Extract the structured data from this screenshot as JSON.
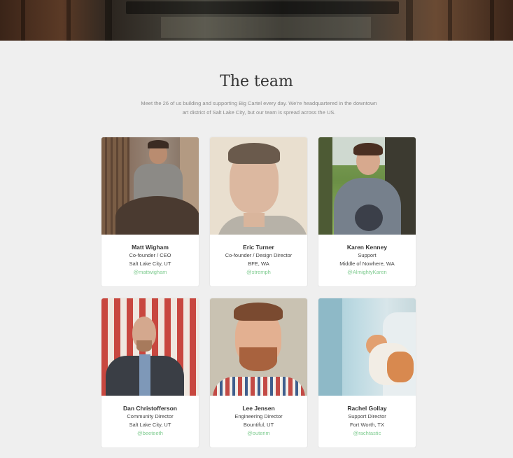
{
  "section": {
    "title": "The team",
    "intro": "Meet the 26 of us building and supporting Big Cartel every day. We're headquartered in the downtown art district of Salt Lake City, but our team is spread across the US."
  },
  "members": [
    {
      "name": "Matt Wigham",
      "role": "Co-founder / CEO",
      "location": "Salt Lake City, UT",
      "handle": "@mattwigham"
    },
    {
      "name": "Eric Turner",
      "role": "Co-founder / Design Director",
      "location": "BFE, WA",
      "handle": "@stremph"
    },
    {
      "name": "Karen Kenney",
      "role": "Support",
      "location": "Middle of Nowhere, WA",
      "handle": "@AlmightyKaren"
    },
    {
      "name": "Dan Christofferson",
      "role": "Community Director",
      "location": "Salt Lake City, UT",
      "handle": "@beeteeth"
    },
    {
      "name": "Lee Jensen",
      "role": "Engineering Director",
      "location": "Bountiful, UT",
      "handle": "@outerim"
    },
    {
      "name": "Rachel Gollay",
      "role": "Support Director",
      "location": "Fort Worth, TX",
      "handle": "@rachtastic"
    }
  ],
  "colors": {
    "background": "#efefef",
    "card": "#ffffff",
    "handle": "#7ecb8f",
    "title": "#333333"
  }
}
